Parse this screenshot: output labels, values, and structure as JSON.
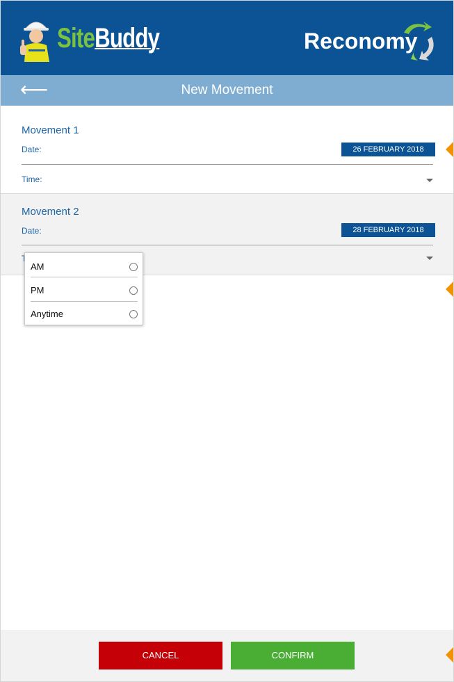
{
  "brand": {
    "app_name_part1": "Site",
    "app_name_part2": "Buddy",
    "partner_name": "Reconomy"
  },
  "header": {
    "back_label": "⟵",
    "title": "New Movement"
  },
  "movements": [
    {
      "title": "Movement 1",
      "date_label": "Date:",
      "date_value": "26 FEBRUARY 2018",
      "time_label": "Time:"
    },
    {
      "title": "Movement 2",
      "date_label": "Date:",
      "date_value": "28 FEBRUARY 2018",
      "time_label": "T"
    }
  ],
  "time_options": [
    "AM",
    "PM",
    "Anytime"
  ],
  "footer": {
    "cancel_label": "CANCEL",
    "confirm_label": "CONFIRM"
  },
  "colors": {
    "brand_blue": "#0b5394",
    "subheader_blue": "#7fadd2",
    "cancel_red": "#c50006",
    "confirm_green": "#4aae35",
    "marker_orange": "#f39200"
  }
}
